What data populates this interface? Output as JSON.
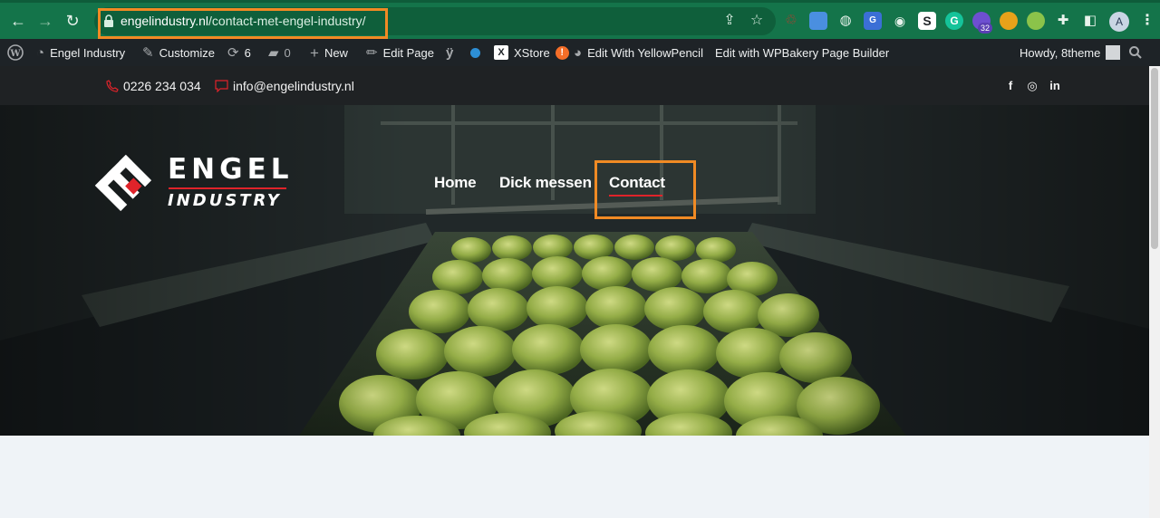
{
  "browser": {
    "url_host": "engelindustry.nl",
    "url_path": "/contact-met-engel-industry/",
    "profile_initial": "A",
    "extension_badge": "32",
    "accent": "#14744a",
    "highlight_color": "#f08a24"
  },
  "adminbar": {
    "site_name": "Engel Industry",
    "customize": "Customize",
    "updates_count": "6",
    "comments_count": "0",
    "new": "New",
    "edit_page": "Edit Page",
    "xstore": "XStore",
    "xstore_alert": "!",
    "yellowpencil": "Edit With YellowPencil",
    "wpbakery": "Edit with WPBakery Page Builder",
    "howdy": "Howdy, 8theme"
  },
  "topbar": {
    "phone": "0226 234 034",
    "email": "info@engelindustry.nl",
    "social": [
      "f",
      "◎",
      "in"
    ]
  },
  "logo": {
    "word": "ENGEL",
    "sub": "INDUSTRY",
    "accent": "#e0232a"
  },
  "menu": {
    "items": [
      "Home",
      "Dick messen",
      "Contact"
    ],
    "active": "Contact"
  }
}
